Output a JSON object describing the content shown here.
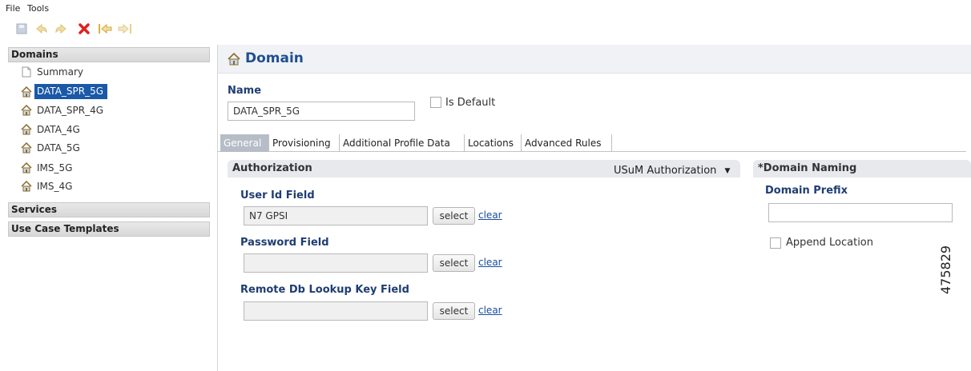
{
  "menu": {
    "file": "File",
    "tools": "Tools"
  },
  "toolbar": [
    "save-icon",
    "undo-icon",
    "redo-icon",
    "delete-icon",
    "move-left-icon",
    "move-right-icon"
  ],
  "sidebar": {
    "domains_header": "Domains",
    "items": [
      {
        "label": "Summary",
        "icon": "document-icon"
      },
      {
        "label": "DATA_SPR_5G",
        "icon": "house-icon",
        "selected": true
      },
      {
        "label": "DATA_SPR_4G",
        "icon": "house-icon"
      },
      {
        "label": "DATA_4G",
        "icon": "house-icon"
      },
      {
        "label": "DATA_5G",
        "icon": "house-icon"
      },
      {
        "label": "IMS_5G",
        "icon": "house-icon"
      },
      {
        "label": "IMS_4G",
        "icon": "house-icon"
      }
    ],
    "services_header": "Services",
    "templates_header": "Use Case Templates"
  },
  "main": {
    "title": "Domain",
    "name_label": "Name",
    "name_value": "DATA_SPR_5G",
    "is_default_label": "Is Default",
    "tabs": [
      "General",
      "Provisioning",
      "Additional Profile Data",
      "Locations",
      "Advanced Rules"
    ],
    "authorization": {
      "header": "Authorization",
      "dropdown_value": "USuM Authorization",
      "user_id_label": "User Id Field",
      "user_id_value": "N7 GPSI",
      "password_label": "Password Field",
      "password_value": "",
      "remote_label": "Remote Db Lookup Key Field",
      "remote_value": "",
      "select_label": "select",
      "clear_label": "clear"
    },
    "naming": {
      "header": "*Domain Naming",
      "prefix_label": "Domain Prefix",
      "prefix_value": "",
      "append_label": "Append Location"
    }
  },
  "figure_number": "475829",
  "colors": {
    "accent": "#1a58a8",
    "title": "#1f4f91",
    "label": "#1f3d73"
  }
}
